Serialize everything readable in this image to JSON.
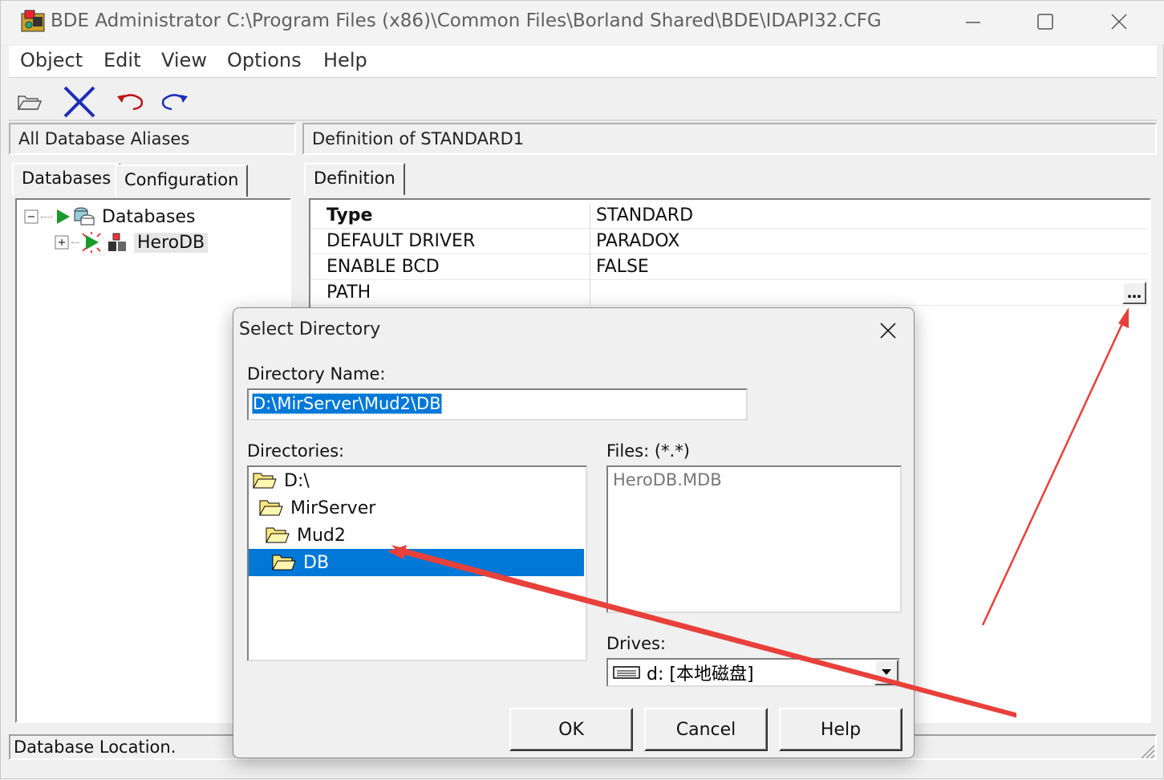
{
  "window": {
    "title": "BDE Administrator  C:\\Program Files (x86)\\Common Files\\Borland Shared\\BDE\\IDAPI32.CFG"
  },
  "menu": [
    "Object",
    "Edit",
    "View",
    "Options",
    "Help"
  ],
  "left_panel": {
    "header": "All Database Aliases",
    "tabs": [
      "Databases",
      "Configuration"
    ],
    "tree": {
      "root": "Databases",
      "child": "HeroDB"
    }
  },
  "right_panel": {
    "header": "Definition of STANDARD1",
    "tab": "Definition",
    "rows": [
      {
        "key": "Type",
        "value": "STANDARD"
      },
      {
        "key": "DEFAULT DRIVER",
        "value": "PARADOX"
      },
      {
        "key": "ENABLE BCD",
        "value": "FALSE"
      },
      {
        "key": "PATH",
        "value": ""
      }
    ],
    "ellipsis": "…"
  },
  "status": "Database Location.",
  "dialog": {
    "title": "Select Directory",
    "directory_name_label": "Directory Name:",
    "directory_name_value": "D:\\MirServer\\Mud2\\DB",
    "directories_label": "Directories:",
    "directories": [
      "D:\\",
      "MirServer",
      "Mud2",
      "DB"
    ],
    "selected_directory": "DB",
    "files_label": "Files: (*.*)",
    "files": [
      "HeroDB.MDB"
    ],
    "drives_label": "Drives:",
    "drive_value": "d: [本地磁盘]",
    "buttons": {
      "ok": "OK",
      "cancel": "Cancel",
      "help": "Help"
    }
  },
  "colors": {
    "selection": "#0078d7",
    "annotation_arrow": "#e8403a"
  }
}
